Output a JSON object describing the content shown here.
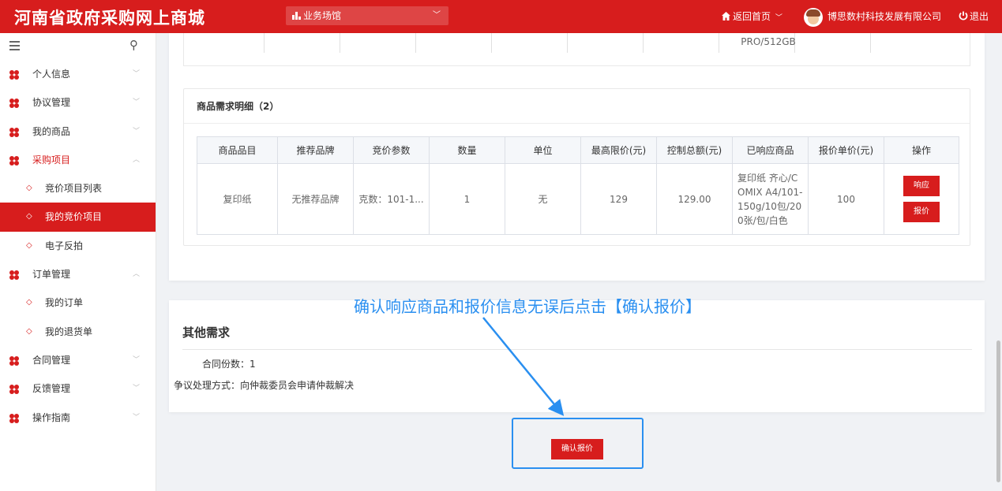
{
  "header": {
    "logo": "河南省政府采购网上商城",
    "venue": "业务场馆",
    "home": "返回首页",
    "company": "博思数村科技发展有限公司",
    "logout": "退出"
  },
  "sidebar": {
    "items": [
      {
        "label": "个人信息",
        "arrow": "﹀"
      },
      {
        "label": "协议管理",
        "arrow": "﹀"
      },
      {
        "label": "我的商品",
        "arrow": "﹀"
      },
      {
        "label": "采购项目",
        "arrow": "︿"
      },
      {
        "label": "竞价项目列表"
      },
      {
        "label": "我的竞价项目"
      },
      {
        "label": "电子反拍"
      },
      {
        "label": "订单管理",
        "arrow": "︿"
      },
      {
        "label": "我的订单"
      },
      {
        "label": "我的退货单"
      },
      {
        "label": "合同管理",
        "arrow": "﹀"
      },
      {
        "label": "反馈管理",
        "arrow": "﹀"
      },
      {
        "label": "操作指南",
        "arrow": "﹀"
      }
    ]
  },
  "top_table": {
    "partial_cell": "PRO/512GB"
  },
  "detail": {
    "title": "商品需求明细（2）",
    "columns": [
      "商品品目",
      "推荐品牌",
      "竞价参数",
      "数量",
      "单位",
      "最高限价(元)",
      "控制总额(元)",
      "已响应商品",
      "报价单价(元)",
      "操作"
    ],
    "row": {
      "category": "复印纸",
      "brand": "无推荐品牌",
      "params": "克数：101-1...",
      "quantity": "1",
      "unit": "无",
      "max_price": "129",
      "total": "129.00",
      "responded": "复印纸 齐心/COMIX A4/101-150g/10包/200张/包/白色",
      "quote": "100",
      "btn_respond": "响应",
      "btn_quote": "报价"
    }
  },
  "other": {
    "title": "其他需求",
    "contract_copies": "合同份数：1",
    "dispute": "争议处理方式：向仲裁委员会申请仲裁解决"
  },
  "annotation": "确认响应商品和报价信息无误后点击【确认报价】",
  "confirm_button": "确认报价",
  "colors": {
    "brand": "#d71d1d",
    "annotation": "#2a8ff0"
  }
}
